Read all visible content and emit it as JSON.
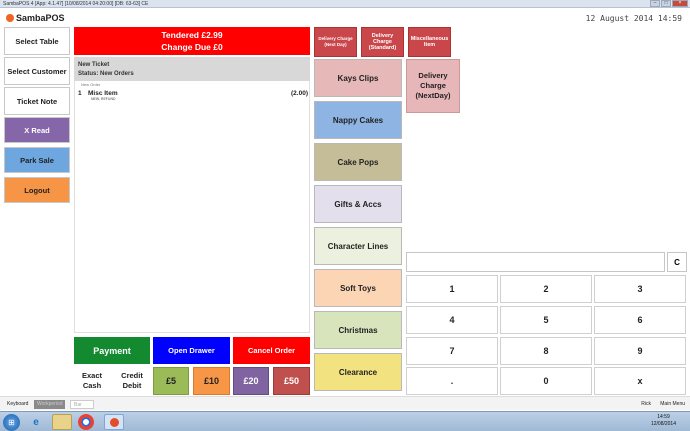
{
  "window": {
    "title": "SambaPOS 4 [App: 4.1.47] [10/08/2014 04:20:00] [DB: 63-63] CE"
  },
  "logo": {
    "text": "SambaPOS"
  },
  "date": "12 August 2014 14:59",
  "left_buttons": [
    {
      "label": "Select Table",
      "bg": "#ffffff",
      "color": "#222222"
    },
    {
      "label": "Select Customer",
      "bg": "#ffffff",
      "color": "#222222"
    },
    {
      "label": "Ticket Note",
      "bg": "#ffffff",
      "color": "#222222"
    },
    {
      "label": "X Read",
      "bg": "#8566a8",
      "color": "#ffffff"
    },
    {
      "label": "Park Sale",
      "bg": "#6ea6e0",
      "color": "#222222"
    },
    {
      "label": "Logout",
      "bg": "#f79546",
      "color": "#222222"
    }
  ],
  "ticket": {
    "tendered": "Tendered £2.99",
    "change_due": "Change Due £0",
    "title": "New Ticket",
    "status": "Status: New Orders",
    "new_order_label": "New Order",
    "lines": [
      {
        "qty": "1",
        "name": "Misc Item",
        "price": "(2.00)",
        "sub": "NEW, REFUND"
      }
    ]
  },
  "actions": {
    "payment": "Payment",
    "open_drawer": "Open Drawer",
    "cancel_order": "Cancel Order",
    "exact_cash": "Exact Cash",
    "credit_debit": "Credit Debit",
    "five": "£5",
    "ten": "£10",
    "twenty": "£20",
    "fifty": "£50"
  },
  "top_items": [
    {
      "label": "Delivery Charge (Next Day)"
    },
    {
      "label": "Delivery Charge (Standard)"
    },
    {
      "label": "Miscellaneous Item"
    }
  ],
  "categories": [
    {
      "label": "Kays Clips",
      "bg": "#e6b8b7"
    },
    {
      "label": "Nappy Cakes",
      "bg": "#8db4e2"
    },
    {
      "label": "Cake Pops",
      "bg": "#c4bd97"
    },
    {
      "label": "Gifts & Accs",
      "bg": "#e4dfec"
    },
    {
      "label": "Character Lines",
      "bg": "#ebf1de"
    },
    {
      "label": "Soft Toys",
      "bg": "#fcd5b4"
    },
    {
      "label": "Christmas",
      "bg": "#d8e4bc"
    },
    {
      "label": "Clearance",
      "bg": "#f2e280"
    }
  ],
  "product": {
    "label": "Delivery Charge (NextDay)"
  },
  "numpad": {
    "display_value": "",
    "clear": "C",
    "keys": [
      "1",
      "2",
      "3",
      "4",
      "5",
      "6",
      "7",
      "8",
      "9",
      ".",
      "0",
      "x"
    ]
  },
  "bottom_bar": {
    "keyboard": "Keyboard",
    "btn2": "Workperiod",
    "btn3": "Bar",
    "user": "Rick",
    "main_menu": "Main Menu"
  },
  "taskbar": {
    "time": "14:59",
    "date": "12/08/2014"
  }
}
